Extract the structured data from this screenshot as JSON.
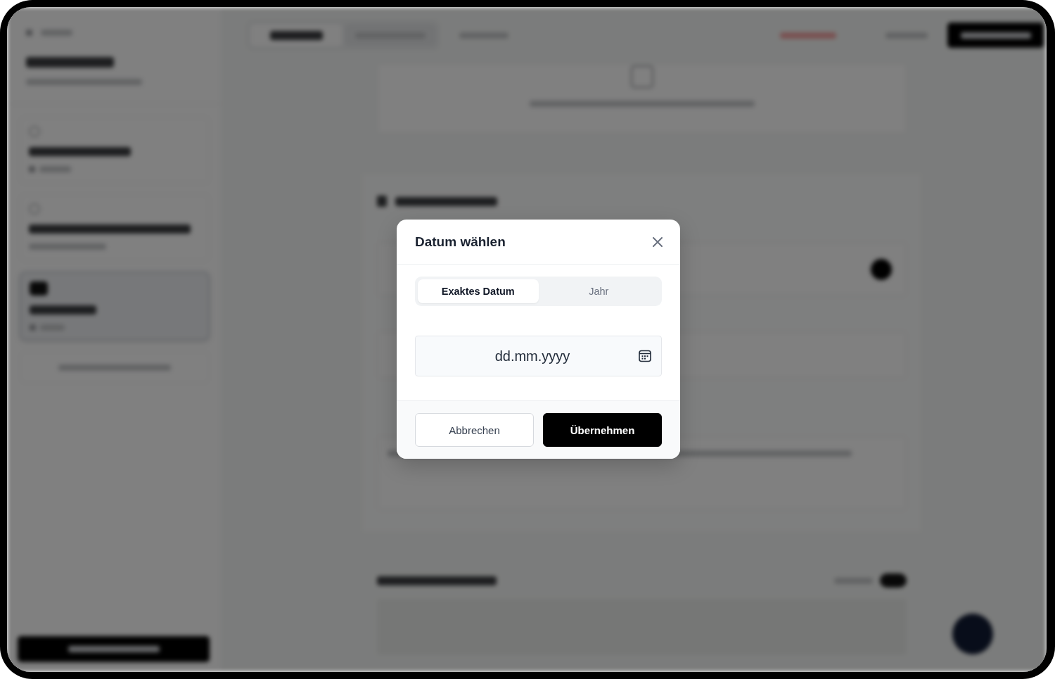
{
  "dialog": {
    "title": "Datum wählen",
    "mode_tabs": [
      {
        "label": "Exaktes Datum",
        "selected": true
      },
      {
        "label": "Jahr",
        "selected": false
      }
    ],
    "date_field": {
      "placeholder": "dd.mm.yyyy"
    },
    "buttons": [
      {
        "label": "Abbrechen",
        "kind": "secondary"
      },
      {
        "label": "Übernehmen",
        "kind": "primary"
      }
    ]
  }
}
